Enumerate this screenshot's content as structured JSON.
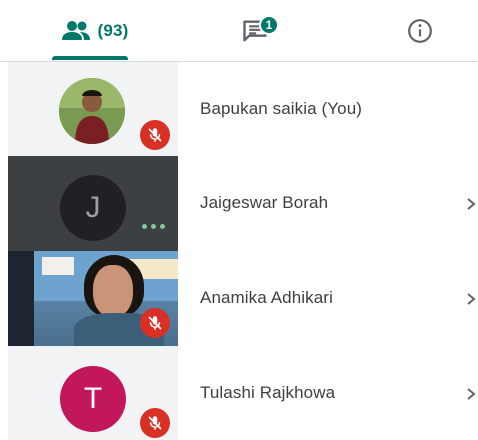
{
  "tabs": {
    "people": {
      "icon": "people-icon",
      "count_label": "(93)"
    },
    "chat": {
      "icon": "chat-icon",
      "badge": "1"
    },
    "info": {
      "icon": "info-icon"
    }
  },
  "colors": {
    "accent": "#00796b",
    "mic_off": "#d93025",
    "avatar_t": "#c2185b",
    "tile_dark": "#3c4043",
    "tile_light": "#f1f3f4"
  },
  "participants": [
    {
      "name": "Bapukan saikia (You)",
      "avatar": "photo",
      "mic": "muted"
    },
    {
      "name": "Jaigeswar Borah",
      "avatar_letter": "J",
      "status": "speaking-dots"
    },
    {
      "name": "Anamika Adhikari",
      "avatar": "video",
      "mic": "muted"
    },
    {
      "name": "Tulashi Rajkhowa",
      "avatar_letter": "T",
      "mic": "muted"
    }
  ]
}
